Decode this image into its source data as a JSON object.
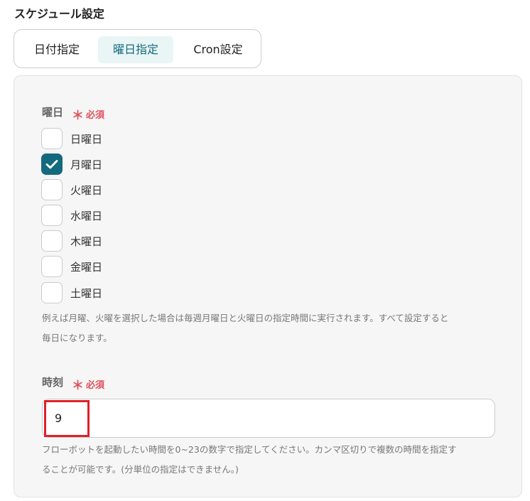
{
  "section_title": "スケジュール設定",
  "tabs": [
    {
      "label": "日付指定",
      "active": false
    },
    {
      "label": "曜日指定",
      "active": true
    },
    {
      "label": "Cron設定",
      "active": false
    }
  ],
  "weekday_field": {
    "label": "曜日",
    "required_text": "必須",
    "options": [
      {
        "label": "日曜日",
        "checked": false
      },
      {
        "label": "月曜日",
        "checked": true
      },
      {
        "label": "火曜日",
        "checked": false
      },
      {
        "label": "水曜日",
        "checked": false
      },
      {
        "label": "木曜日",
        "checked": false
      },
      {
        "label": "金曜日",
        "checked": false
      },
      {
        "label": "土曜日",
        "checked": false
      }
    ],
    "help_line1": "例えば月曜、火曜を選択した場合は毎週月曜日と火曜日の指定時間に実行されます。すべて設定すると",
    "help_line2": "毎日になります。"
  },
  "time_field": {
    "label": "時刻",
    "required_text": "必須",
    "value": "9",
    "help_line1": "フローボットを起動したい時間を0~23の数字で指定してください。カンマ区切りで複数の時間を指定す",
    "help_line2": "ることが可能です。(分単位の指定はできません。)"
  },
  "colors": {
    "accent": "#136a7d",
    "required": "#e0505a",
    "highlight": "#e0202a"
  }
}
